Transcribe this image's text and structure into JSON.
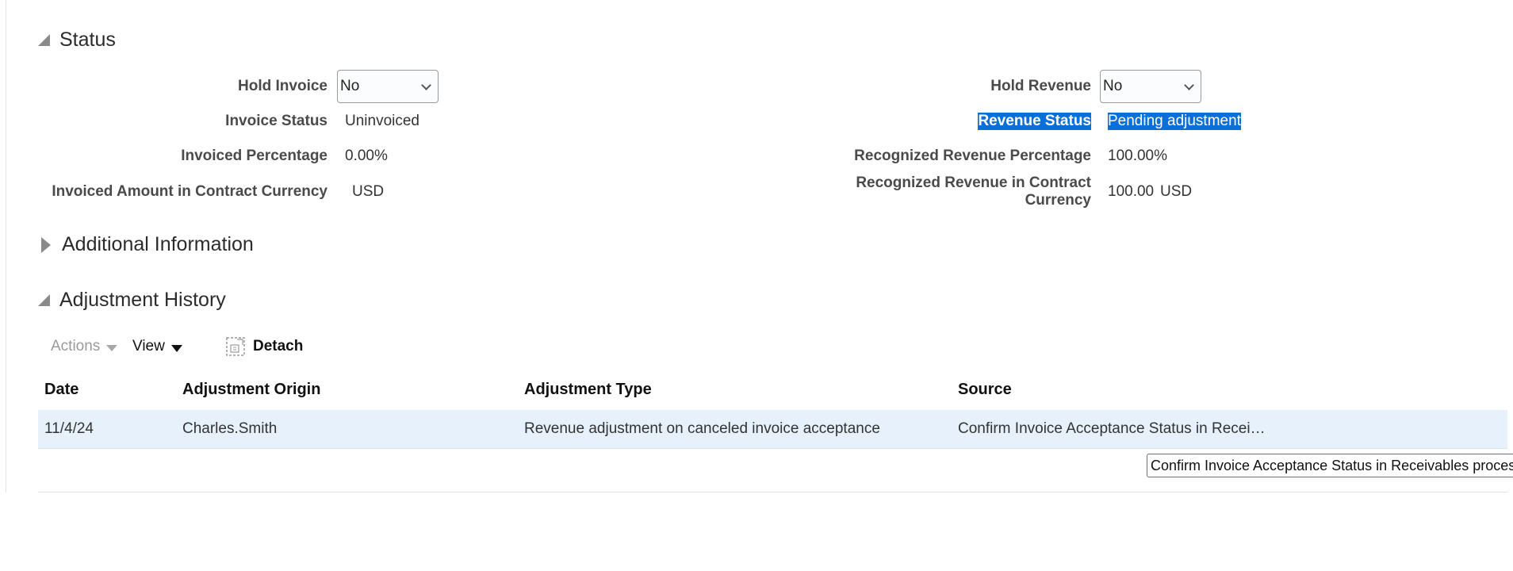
{
  "status_section": {
    "title": "Status",
    "hold_invoice": {
      "label": "Hold Invoice",
      "value": "No"
    },
    "invoice_status": {
      "label": "Invoice Status",
      "value": "Uninvoiced"
    },
    "invoiced_percentage": {
      "label": "Invoiced Percentage",
      "value": "0.00%"
    },
    "invoiced_amount": {
      "label": "Invoiced Amount in Contract Currency",
      "currency": "USD"
    },
    "hold_revenue": {
      "label": "Hold Revenue",
      "value": "No"
    },
    "revenue_status": {
      "label": "Revenue Status",
      "value": "Pending adjustment"
    },
    "recognized_revenue_percentage": {
      "label": "Recognized Revenue Percentage",
      "value": "100.00%"
    },
    "recognized_revenue_amount": {
      "label_line1": "Recognized Revenue in Contract",
      "label_line2": "Currency",
      "amount": "100.00",
      "currency": "USD"
    }
  },
  "additional_section": {
    "title": "Additional Information"
  },
  "history_section": {
    "title": "Adjustment History",
    "toolbar": {
      "actions": "Actions",
      "view": "View",
      "detach": "Detach"
    },
    "columns": {
      "date": "Date",
      "origin": "Adjustment Origin",
      "type": "Adjustment Type",
      "source": "Source"
    },
    "rows": [
      {
        "date": "11/4/24",
        "origin": "Charles.Smith",
        "type": "Revenue adjustment on canceled invoice acceptance",
        "source": "Confirm Invoice Acceptance Status in Recei…"
      }
    ],
    "tooltip": "Confirm Invoice Acceptance Status in Receivables process"
  },
  "colors": {
    "selection_highlight": "#0a6fd6",
    "row_highlight": "#e6f1fc"
  }
}
